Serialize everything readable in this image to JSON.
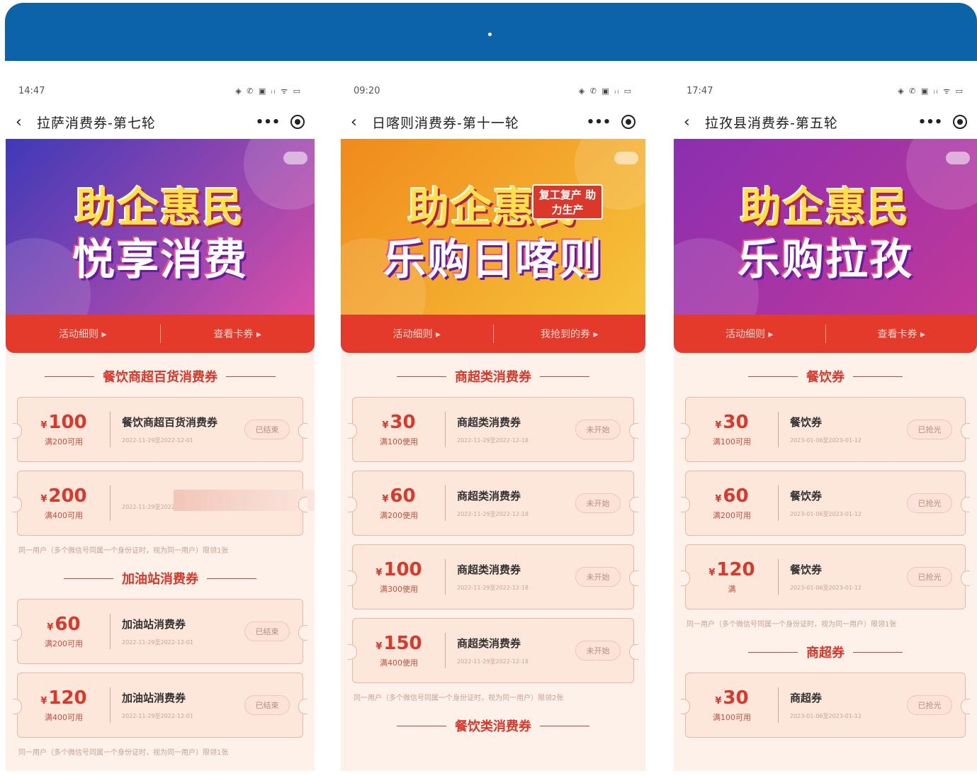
{
  "banner": {
    "dot": "·"
  },
  "phones": [
    {
      "time": "14:47",
      "status_icons": "◈ ✆ ▣ ᵢₗ ᯤ ▭",
      "title": "拉萨消费券-第七轮",
      "hero": {
        "line1": "助企惠民",
        "line2": "悦享消费",
        "colors": [
          "#3e3ab8",
          "#d94fa8"
        ]
      },
      "tabs": [
        "活动细则 ▸",
        "查看卡券 ▸"
      ],
      "sections": [
        {
          "title": "餐饮商超百货消费券",
          "coupons": [
            {
              "price": "100",
              "cond": "满200可用",
              "name": "餐饮商超百货消费券",
              "date": "2022-11-29至2022-12-01",
              "status": "已结束"
            },
            {
              "price": "200",
              "cond": "满400可用",
              "name": "",
              "date": "2022-11-29至2022-12-02",
              "status": ""
            }
          ],
          "note": "同一用户（多个微信号同属一个身份证时，视为同一用户）限领1张"
        },
        {
          "title": "加油站消费券",
          "coupons": [
            {
              "price": "60",
              "cond": "满200可用",
              "name": "加油站消费券",
              "date": "2022-11-29至2022-12-01",
              "status": "已结束"
            },
            {
              "price": "120",
              "cond": "满400可用",
              "name": "加油站消费券",
              "date": "2022-11-29至2022-12-01",
              "status": "已结束"
            }
          ],
          "note": "同一用户（多个微信号同属一个身份证时，视为同一用户）限领1张"
        }
      ]
    },
    {
      "time": "09:20",
      "status_icons": "◈ ✆ ▣ ᵢₗ ▭",
      "title": "日喀则消费券-第十一轮",
      "hero": {
        "line1": "助企惠民",
        "line2": "乐购日喀则",
        "tag": "复工复产 助力生产",
        "colors": [
          "#f08a1c",
          "#f6c43a"
        ]
      },
      "tabs": [
        "活动细则 ▸",
        "我抢到的券 ▸"
      ],
      "sections": [
        {
          "title": "商超类消费券",
          "coupons": [
            {
              "price": "30",
              "cond": "满100使用",
              "name": "商超类消费券",
              "date": "2022-11-29至2022-12-18",
              "status": "未开始"
            },
            {
              "price": "60",
              "cond": "满200使用",
              "name": "商超类消费券",
              "date": "2022-11-29至2022-12-18",
              "status": "未开始"
            },
            {
              "price": "100",
              "cond": "满300使用",
              "name": "商超类消费券",
              "date": "2022-11-29至2022-12-18",
              "status": "未开始"
            },
            {
              "price": "150",
              "cond": "满400使用",
              "name": "商超类消费券",
              "date": "2022-11-29至2022-12-18",
              "status": "未开始"
            }
          ],
          "note": "同一用户（多个微信号同属一个身份证时，视为同一用户）限领2张"
        },
        {
          "title": "餐饮类消费券",
          "coupons": [],
          "note": ""
        }
      ]
    },
    {
      "time": "17:47",
      "status_icons": "◈ ✆ ▣ ᵢₗ ᯤ ▭",
      "title": "拉孜县消费券-第五轮",
      "hero": {
        "line1": "助企惠民",
        "line2": "乐购拉孜",
        "colors": [
          "#8a2fb0",
          "#c0389a"
        ]
      },
      "tabs": [
        "活动细则 ▸",
        "查看卡券 ▸"
      ],
      "sections": [
        {
          "title": "餐饮券",
          "coupons": [
            {
              "price": "30",
              "cond": "满100可用",
              "name": "餐饮券",
              "date": "2023-01-06至2023-01-12",
              "status": "已抢光"
            },
            {
              "price": "60",
              "cond": "满200可用",
              "name": "餐饮券",
              "date": "2023-01-06至2023-01-12",
              "status": "已抢光"
            },
            {
              "price": "120",
              "cond": "满",
              "name": "餐饮券",
              "date": "2023-01-06至2023-01-12",
              "status": "已抢光"
            }
          ],
          "note": "同一用户（多个微信号同属一个身份证时，视为同一用户）限领1张"
        },
        {
          "title": "商超券",
          "coupons": [
            {
              "price": "30",
              "cond": "满100可用",
              "name": "商超券",
              "date": "2023-01-06至2023-01-12",
              "status": "已抢光"
            }
          ],
          "note": ""
        }
      ]
    }
  ]
}
